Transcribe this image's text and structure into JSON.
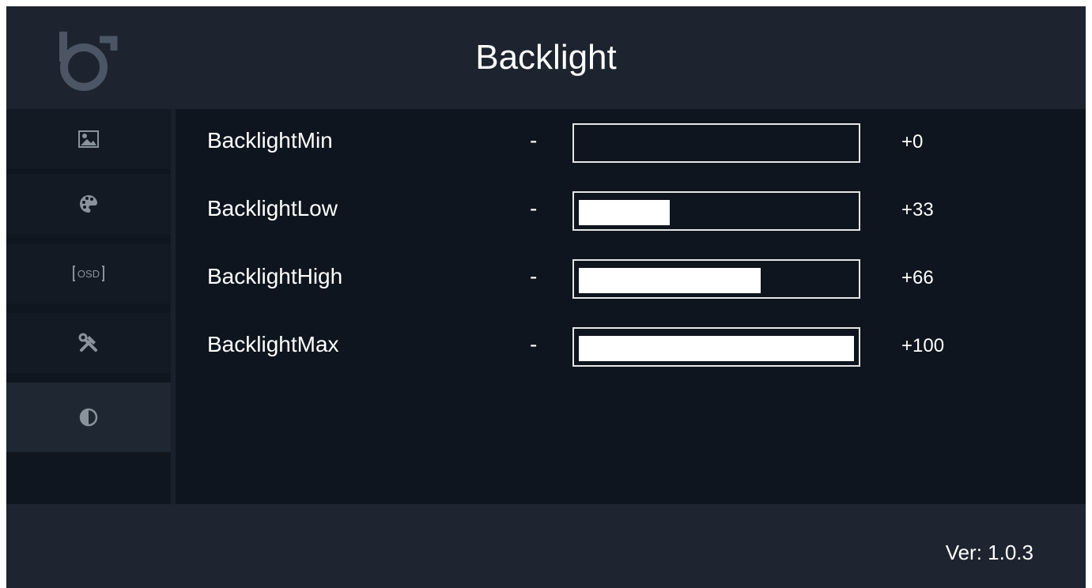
{
  "header": {
    "title": "Backlight",
    "logo_icon": "brand-logo-icon"
  },
  "sidebar": {
    "items": [
      {
        "icon": "picture-icon",
        "active": false
      },
      {
        "icon": "palette-icon",
        "active": false
      },
      {
        "icon": "osd-icon",
        "label": "OSD",
        "active": false
      },
      {
        "icon": "tools-icon",
        "active": false
      },
      {
        "icon": "contrast-icon",
        "active": true
      }
    ],
    "accent_color": "#1f6fe0"
  },
  "settings": [
    {
      "label": "BacklightMin",
      "minus": "-",
      "value": "+0",
      "level": 0
    },
    {
      "label": "BacklightLow",
      "minus": "-",
      "value": "+33",
      "level": 33
    },
    {
      "label": "BacklightHigh",
      "minus": "-",
      "value": "+66",
      "level": 66
    },
    {
      "label": "BacklightMax",
      "minus": "-",
      "value": "+100",
      "level": 100
    }
  ],
  "footer": {
    "version": "Ver: 1.0.3"
  }
}
